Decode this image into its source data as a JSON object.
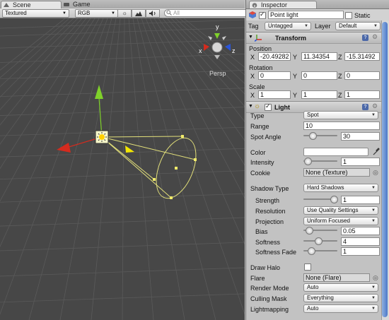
{
  "scene_tabs": {
    "scene": "Scene",
    "game": "Game"
  },
  "scene_toolbar": {
    "draw_mode": "Textured",
    "render_mode": "RGB",
    "search_placeholder": "All"
  },
  "viewport": {
    "projection_label": "Persp",
    "gizmo_axes": {
      "y": "y",
      "x": "x",
      "z": "z"
    }
  },
  "inspector": {
    "tab": "Inspector",
    "object_name": "Point light",
    "static_label": "Static",
    "tag_label": "Tag",
    "tag_value": "Untagged",
    "layer_label": "Layer",
    "layer_value": "Default",
    "transform": {
      "title": "Transform",
      "position_label": "Position",
      "position": {
        "x": "-20.49282",
        "y": "11.34354",
        "z": "-15.31492"
      },
      "rotation_label": "Rotation",
      "rotation": {
        "x": "0",
        "y": "0",
        "z": "0"
      },
      "scale_label": "Scale",
      "scale": {
        "x": "1",
        "y": "1",
        "z": "1"
      },
      "axis_x": "X",
      "axis_y": "Y",
      "axis_z": "Z"
    },
    "light": {
      "title": "Light",
      "type_label": "Type",
      "type_value": "Spot",
      "range_label": "Range",
      "range_value": "10",
      "spot_angle_label": "Spot Angle",
      "spot_angle_value": "30",
      "color_label": "Color",
      "intensity_label": "Intensity",
      "intensity_value": "1",
      "cookie_label": "Cookie",
      "cookie_value": "None (Texture)",
      "shadow_type_label": "Shadow Type",
      "shadow_type_value": "Hard Shadows",
      "strength_label": "Strength",
      "strength_value": "1",
      "resolution_label": "Resolution",
      "resolution_value": "Use Quality Settings",
      "projection_label": "Projection",
      "projection_value": "Uniform Focused",
      "bias_label": "Bias",
      "bias_value": "0.05",
      "softness_label": "Softness",
      "softness_value": "4",
      "softness_fade_label": "Softness Fade",
      "softness_fade_value": "1",
      "draw_halo_label": "Draw Halo",
      "flare_label": "Flare",
      "flare_value": "None (Flare)",
      "render_mode_label": "Render Mode",
      "render_mode_value": "Auto",
      "culling_mask_label": "Culling Mask",
      "culling_mask_value": "Everything",
      "lightmapping_label": "Lightmapping",
      "lightmapping_value": "Auto"
    }
  },
  "colors": {
    "viewport_bg": "#474747",
    "grid_line": "#5a5a5a",
    "axis_x": "#d42b1e",
    "axis_y": "#7fd12a",
    "axis_z": "#2a55d8",
    "spot_cone": "#e3e07a",
    "inspector_bg": "#c2c2c2"
  }
}
